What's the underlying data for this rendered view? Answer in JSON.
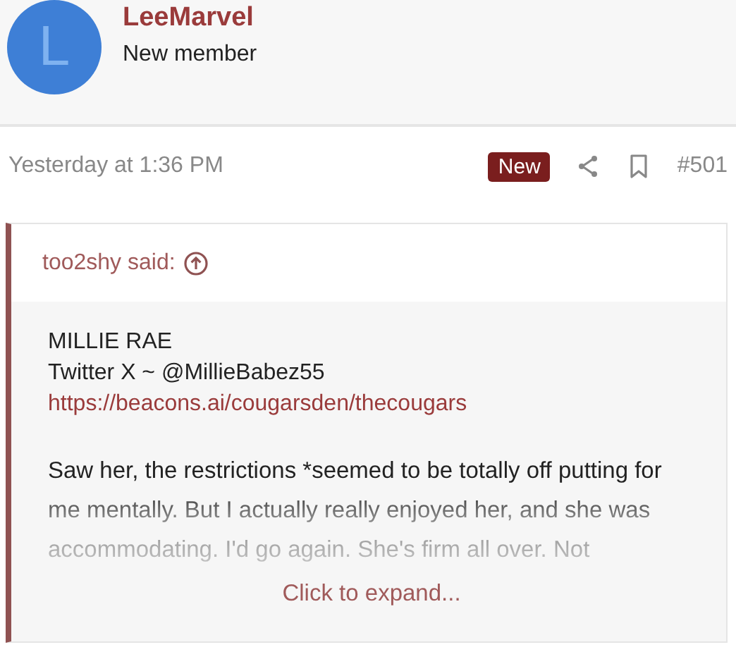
{
  "author": {
    "avatar_letter": "L",
    "name": "LeeMarvel",
    "role": "New member"
  },
  "post": {
    "time": "Yesterday at 1:36 PM",
    "badge": "New",
    "number": "#501"
  },
  "quote": {
    "author": "too2shy said:",
    "lines": [
      "MILLIE RAE",
      "Twitter X ~ @MillieBabez55"
    ],
    "link": "https://beacons.ai/cougarsden/thecougars",
    "paragraph": "Saw her, the restrictions *seemed to be totally off putting for me mentally. But I actually really enjoyed her, and she was accommodating. I'd go again. She's firm all over. Not",
    "expand": "Click to expand..."
  }
}
